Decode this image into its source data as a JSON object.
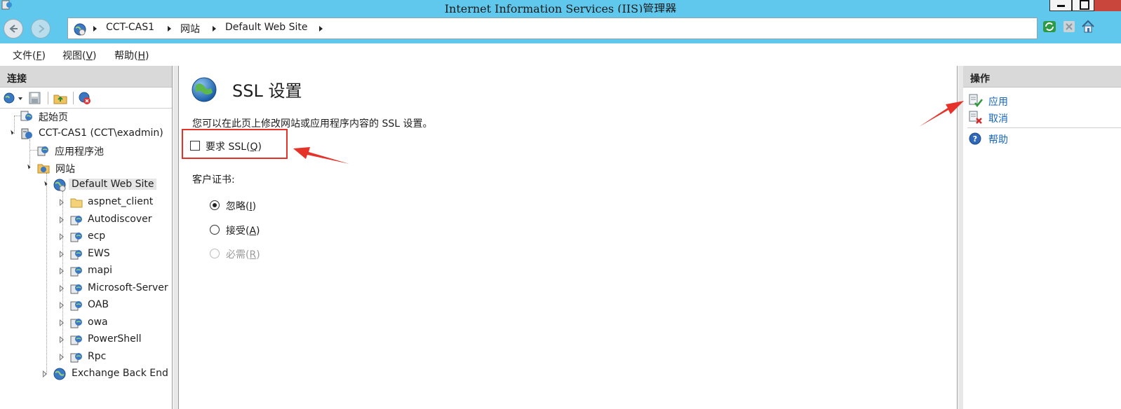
{
  "window": {
    "title": "Internet Information Services (IIS)管理器"
  },
  "address": {
    "crumbs": [
      "CCT-CAS1",
      "网站",
      "Default Web Site"
    ]
  },
  "menu": {
    "items": [
      {
        "text": "文件(",
        "key": "F",
        "end": ")"
      },
      {
        "text": "视图(",
        "key": "V",
        "end": ")"
      },
      {
        "text": "帮助(",
        "key": "H",
        "end": ")"
      }
    ]
  },
  "connections": {
    "header": "连接",
    "tree": [
      {
        "label": "起始页",
        "icon": "start-page-icon"
      },
      {
        "label": "CCT-CAS1 (CCT\\exadmin)",
        "icon": "server-icon"
      },
      {
        "label": "应用程序池",
        "icon": "app-pool-icon"
      },
      {
        "label": "网站",
        "icon": "sites-folder-icon"
      },
      {
        "label": "Default Web Site",
        "icon": "website-globe-icon"
      },
      {
        "label": "aspnet_client",
        "icon": "folder-icon"
      },
      {
        "label": "Autodiscover",
        "icon": "application-icon"
      },
      {
        "label": "ecp",
        "icon": "application-icon"
      },
      {
        "label": "EWS",
        "icon": "application-icon"
      },
      {
        "label": "mapi",
        "icon": "application-icon"
      },
      {
        "label": "Microsoft-Server",
        "icon": "application-icon"
      },
      {
        "label": "OAB",
        "icon": "application-icon"
      },
      {
        "label": "owa",
        "icon": "application-icon"
      },
      {
        "label": "PowerShell",
        "icon": "application-icon"
      },
      {
        "label": "Rpc",
        "icon": "application-icon"
      },
      {
        "label": "Exchange Back End",
        "icon": "website-globe-icon"
      }
    ]
  },
  "main": {
    "title": "SSL 设置",
    "description": "您可以在此页上修改网站或应用程序内容的 SSL 设置。",
    "require_ssl": {
      "text": "要求 SSL(",
      "key": "Q",
      "end": ")",
      "checked": false
    },
    "client_cert_label": "客户证书:",
    "radios": [
      {
        "text": "忽略(",
        "key": "I",
        "end": ")",
        "selected": true,
        "disabled": false
      },
      {
        "text": "接受(",
        "key": "A",
        "end": ")",
        "selected": false,
        "disabled": false
      },
      {
        "text": "必需(",
        "key": "R",
        "end": ")",
        "selected": false,
        "disabled": true
      }
    ]
  },
  "actions": {
    "header": "操作",
    "items": [
      {
        "label": "应用",
        "icon": "apply-icon"
      },
      {
        "label": "取消",
        "icon": "cancel-icon"
      },
      {
        "label": "帮助",
        "icon": "help-icon"
      }
    ]
  },
  "colors": {
    "titlebar": "#5fc8ec",
    "annotation_red": "#e5332a",
    "link_blue": "#1666c0"
  }
}
